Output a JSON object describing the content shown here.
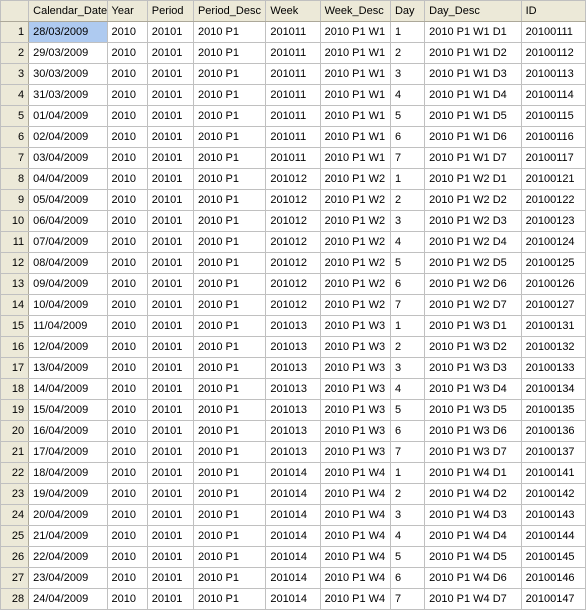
{
  "table": {
    "columns": [
      "Calendar_Date",
      "Year",
      "Period",
      "Period_Desc",
      "Week",
      "Week_Desc",
      "Day",
      "Day_Desc",
      "ID"
    ],
    "rows": [
      {
        "n": 1,
        "Calendar_Date": "28/03/2009",
        "Year": "2010",
        "Period": "20101",
        "Period_Desc": "2010 P1",
        "Week": "201011",
        "Week_Desc": "2010 P1 W1",
        "Day": "1",
        "Day_Desc": "2010 P1 W1 D1",
        "ID": "20100111"
      },
      {
        "n": 2,
        "Calendar_Date": "29/03/2009",
        "Year": "2010",
        "Period": "20101",
        "Period_Desc": "2010 P1",
        "Week": "201011",
        "Week_Desc": "2010 P1 W1",
        "Day": "2",
        "Day_Desc": "2010 P1 W1 D2",
        "ID": "20100112"
      },
      {
        "n": 3,
        "Calendar_Date": "30/03/2009",
        "Year": "2010",
        "Period": "20101",
        "Period_Desc": "2010 P1",
        "Week": "201011",
        "Week_Desc": "2010 P1 W1",
        "Day": "3",
        "Day_Desc": "2010 P1 W1 D3",
        "ID": "20100113"
      },
      {
        "n": 4,
        "Calendar_Date": "31/03/2009",
        "Year": "2010",
        "Period": "20101",
        "Period_Desc": "2010 P1",
        "Week": "201011",
        "Week_Desc": "2010 P1 W1",
        "Day": "4",
        "Day_Desc": "2010 P1 W1 D4",
        "ID": "20100114"
      },
      {
        "n": 5,
        "Calendar_Date": "01/04/2009",
        "Year": "2010",
        "Period": "20101",
        "Period_Desc": "2010 P1",
        "Week": "201011",
        "Week_Desc": "2010 P1 W1",
        "Day": "5",
        "Day_Desc": "2010 P1 W1 D5",
        "ID": "20100115"
      },
      {
        "n": 6,
        "Calendar_Date": "02/04/2009",
        "Year": "2010",
        "Period": "20101",
        "Period_Desc": "2010 P1",
        "Week": "201011",
        "Week_Desc": "2010 P1 W1",
        "Day": "6",
        "Day_Desc": "2010 P1 W1 D6",
        "ID": "20100116"
      },
      {
        "n": 7,
        "Calendar_Date": "03/04/2009",
        "Year": "2010",
        "Period": "20101",
        "Period_Desc": "2010 P1",
        "Week": "201011",
        "Week_Desc": "2010 P1 W1",
        "Day": "7",
        "Day_Desc": "2010 P1 W1 D7",
        "ID": "20100117"
      },
      {
        "n": 8,
        "Calendar_Date": "04/04/2009",
        "Year": "2010",
        "Period": "20101",
        "Period_Desc": "2010 P1",
        "Week": "201012",
        "Week_Desc": "2010 P1 W2",
        "Day": "1",
        "Day_Desc": "2010 P1 W2 D1",
        "ID": "20100121"
      },
      {
        "n": 9,
        "Calendar_Date": "05/04/2009",
        "Year": "2010",
        "Period": "20101",
        "Period_Desc": "2010 P1",
        "Week": "201012",
        "Week_Desc": "2010 P1 W2",
        "Day": "2",
        "Day_Desc": "2010 P1 W2 D2",
        "ID": "20100122"
      },
      {
        "n": 10,
        "Calendar_Date": "06/04/2009",
        "Year": "2010",
        "Period": "20101",
        "Period_Desc": "2010 P1",
        "Week": "201012",
        "Week_Desc": "2010 P1 W2",
        "Day": "3",
        "Day_Desc": "2010 P1 W2 D3",
        "ID": "20100123"
      },
      {
        "n": 11,
        "Calendar_Date": "07/04/2009",
        "Year": "2010",
        "Period": "20101",
        "Period_Desc": "2010 P1",
        "Week": "201012",
        "Week_Desc": "2010 P1 W2",
        "Day": "4",
        "Day_Desc": "2010 P1 W2 D4",
        "ID": "20100124"
      },
      {
        "n": 12,
        "Calendar_Date": "08/04/2009",
        "Year": "2010",
        "Period": "20101",
        "Period_Desc": "2010 P1",
        "Week": "201012",
        "Week_Desc": "2010 P1 W2",
        "Day": "5",
        "Day_Desc": "2010 P1 W2 D5",
        "ID": "20100125"
      },
      {
        "n": 13,
        "Calendar_Date": "09/04/2009",
        "Year": "2010",
        "Period": "20101",
        "Period_Desc": "2010 P1",
        "Week": "201012",
        "Week_Desc": "2010 P1 W2",
        "Day": "6",
        "Day_Desc": "2010 P1 W2 D6",
        "ID": "20100126"
      },
      {
        "n": 14,
        "Calendar_Date": "10/04/2009",
        "Year": "2010",
        "Period": "20101",
        "Period_Desc": "2010 P1",
        "Week": "201012",
        "Week_Desc": "2010 P1 W2",
        "Day": "7",
        "Day_Desc": "2010 P1 W2 D7",
        "ID": "20100127"
      },
      {
        "n": 15,
        "Calendar_Date": "11/04/2009",
        "Year": "2010",
        "Period": "20101",
        "Period_Desc": "2010 P1",
        "Week": "201013",
        "Week_Desc": "2010 P1 W3",
        "Day": "1",
        "Day_Desc": "2010 P1 W3 D1",
        "ID": "20100131"
      },
      {
        "n": 16,
        "Calendar_Date": "12/04/2009",
        "Year": "2010",
        "Period": "20101",
        "Period_Desc": "2010 P1",
        "Week": "201013",
        "Week_Desc": "2010 P1 W3",
        "Day": "2",
        "Day_Desc": "2010 P1 W3 D2",
        "ID": "20100132"
      },
      {
        "n": 17,
        "Calendar_Date": "13/04/2009",
        "Year": "2010",
        "Period": "20101",
        "Period_Desc": "2010 P1",
        "Week": "201013",
        "Week_Desc": "2010 P1 W3",
        "Day": "3",
        "Day_Desc": "2010 P1 W3 D3",
        "ID": "20100133"
      },
      {
        "n": 18,
        "Calendar_Date": "14/04/2009",
        "Year": "2010",
        "Period": "20101",
        "Period_Desc": "2010 P1",
        "Week": "201013",
        "Week_Desc": "2010 P1 W3",
        "Day": "4",
        "Day_Desc": "2010 P1 W3 D4",
        "ID": "20100134"
      },
      {
        "n": 19,
        "Calendar_Date": "15/04/2009",
        "Year": "2010",
        "Period": "20101",
        "Period_Desc": "2010 P1",
        "Week": "201013",
        "Week_Desc": "2010 P1 W3",
        "Day": "5",
        "Day_Desc": "2010 P1 W3 D5",
        "ID": "20100135"
      },
      {
        "n": 20,
        "Calendar_Date": "16/04/2009",
        "Year": "2010",
        "Period": "20101",
        "Period_Desc": "2010 P1",
        "Week": "201013",
        "Week_Desc": "2010 P1 W3",
        "Day": "6",
        "Day_Desc": "2010 P1 W3 D6",
        "ID": "20100136"
      },
      {
        "n": 21,
        "Calendar_Date": "17/04/2009",
        "Year": "2010",
        "Period": "20101",
        "Period_Desc": "2010 P1",
        "Week": "201013",
        "Week_Desc": "2010 P1 W3",
        "Day": "7",
        "Day_Desc": "2010 P1 W3 D7",
        "ID": "20100137"
      },
      {
        "n": 22,
        "Calendar_Date": "18/04/2009",
        "Year": "2010",
        "Period": "20101",
        "Period_Desc": "2010 P1",
        "Week": "201014",
        "Week_Desc": "2010 P1 W4",
        "Day": "1",
        "Day_Desc": "2010 P1 W4 D1",
        "ID": "20100141"
      },
      {
        "n": 23,
        "Calendar_Date": "19/04/2009",
        "Year": "2010",
        "Period": "20101",
        "Period_Desc": "2010 P1",
        "Week": "201014",
        "Week_Desc": "2010 P1 W4",
        "Day": "2",
        "Day_Desc": "2010 P1 W4 D2",
        "ID": "20100142"
      },
      {
        "n": 24,
        "Calendar_Date": "20/04/2009",
        "Year": "2010",
        "Period": "20101",
        "Period_Desc": "2010 P1",
        "Week": "201014",
        "Week_Desc": "2010 P1 W4",
        "Day": "3",
        "Day_Desc": "2010 P1 W4 D3",
        "ID": "20100143"
      },
      {
        "n": 25,
        "Calendar_Date": "21/04/2009",
        "Year": "2010",
        "Period": "20101",
        "Period_Desc": "2010 P1",
        "Week": "201014",
        "Week_Desc": "2010 P1 W4",
        "Day": "4",
        "Day_Desc": "2010 P1 W4 D4",
        "ID": "20100144"
      },
      {
        "n": 26,
        "Calendar_Date": "22/04/2009",
        "Year": "2010",
        "Period": "20101",
        "Period_Desc": "2010 P1",
        "Week": "201014",
        "Week_Desc": "2010 P1 W4",
        "Day": "5",
        "Day_Desc": "2010 P1 W4 D5",
        "ID": "20100145"
      },
      {
        "n": 27,
        "Calendar_Date": "23/04/2009",
        "Year": "2010",
        "Period": "20101",
        "Period_Desc": "2010 P1",
        "Week": "201014",
        "Week_Desc": "2010 P1 W4",
        "Day": "6",
        "Day_Desc": "2010 P1 W4 D6",
        "ID": "20100146"
      },
      {
        "n": 28,
        "Calendar_Date": "24/04/2009",
        "Year": "2010",
        "Period": "20101",
        "Period_Desc": "2010 P1",
        "Week": "201014",
        "Week_Desc": "2010 P1 W4",
        "Day": "7",
        "Day_Desc": "2010 P1 W4 D7",
        "ID": "20100147"
      }
    ],
    "selected": {
      "row": 0,
      "col": "Calendar_Date"
    }
  }
}
